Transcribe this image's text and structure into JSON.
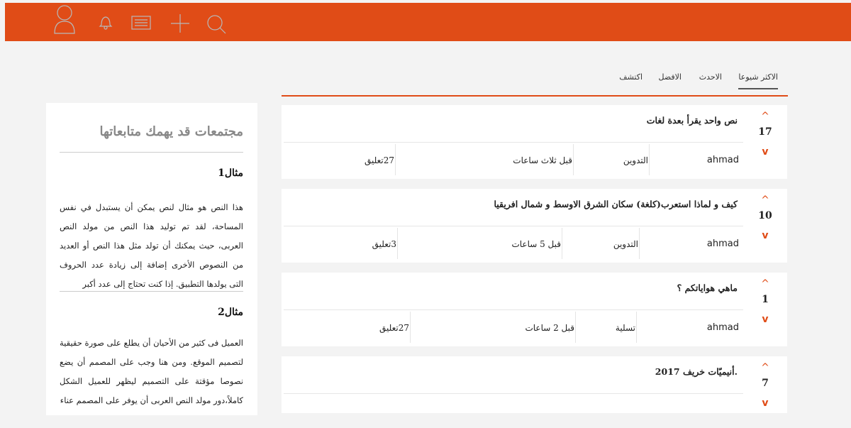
{
  "header": {
    "icons": [
      "profile-icon",
      "bell-icon",
      "news-icon",
      "plus-icon",
      "search-icon"
    ],
    "accent_color": "#e04c17"
  },
  "tabs": [
    {
      "label": "الاكثر شيوعا",
      "active": true
    },
    {
      "label": "الاحدث",
      "active": false
    },
    {
      "label": "الافضل",
      "active": false
    },
    {
      "label": "اكتشف",
      "active": false
    }
  ],
  "posts": [
    {
      "title": "نص واحد يقرأ بعدة لغات",
      "votes": "17",
      "author": "ahmad",
      "category": "التدوين",
      "time": "قبل ثلاث ساعات",
      "comments": "27تعليق"
    },
    {
      "title": "كيف و لماذا استعرب(كلغة) سكان الشرق الاوسط و شمال افريقيا",
      "votes": "10",
      "author": "ahmad",
      "category": "التدوين",
      "time": "قبل 5 ساعات",
      "comments": "3تعليق"
    },
    {
      "title": "ماهي هواياتكم ؟",
      "votes": "1",
      "author": "ahmad",
      "category": "تسلية",
      "time": "قبل 2 ساعات",
      "comments": "27تعليق"
    },
    {
      "title": ".أنيميّات خريف 2017",
      "votes": "7"
    }
  ],
  "vote_symbols": {
    "up": "^",
    "down": "v"
  },
  "sidebar": {
    "title": "مجتمعات قد يهمك متابعاتها",
    "examples": [
      {
        "heading": "مثال1",
        "text": "هذا النص هو مثال لنص يمكن أن يستبدل في نفس المساحة، لقد تم توليد هذا النص من مولد النص العربى، حيث يمكنك أن تولد مثل هذا النص أو العديد من النصوص الأخرى إضافة إلى زيادة عدد الحروف التى يولدها التطبيق. إذا كنت تحتاج إلى عدد أكبر"
      },
      {
        "heading": "مثال2",
        "text": "العميل فى كثير من الأحيان أن يطلع على صورة حقيقية لتصميم الموقع. ومن هنا وجب على المصمم أن يضع نصوصا مؤقتة على التصميم ليظهر للعميل الشكل كاملاً،دور مولد النص العربى أن يوفر على المصمم عناء"
      }
    ]
  }
}
